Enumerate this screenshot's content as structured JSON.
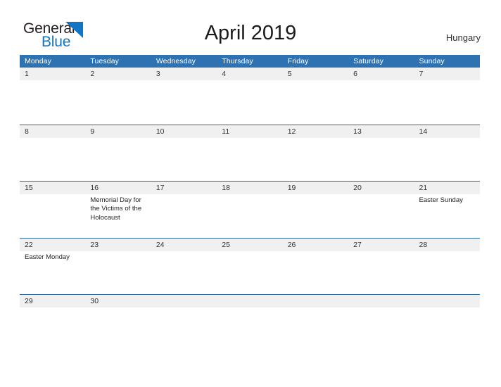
{
  "brand": {
    "name_part1": "General",
    "name_part2": "Blue",
    "mark_icon": "triangle-flag-icon",
    "color_primary": "#1274c4",
    "color_text": "#231f20"
  },
  "header": {
    "title": "April 2019",
    "country": "Hungary"
  },
  "calendar": {
    "header_bg": "#2f72b2",
    "band_bg": "#f0f0f0",
    "rule_color": "#2b669f",
    "weekdays": [
      "Monday",
      "Tuesday",
      "Wednesday",
      "Thursday",
      "Friday",
      "Saturday",
      "Sunday"
    ],
    "weeks": [
      {
        "days": [
          {
            "num": "1",
            "events": []
          },
          {
            "num": "2",
            "events": []
          },
          {
            "num": "3",
            "events": []
          },
          {
            "num": "4",
            "events": []
          },
          {
            "num": "5",
            "events": []
          },
          {
            "num": "6",
            "events": []
          },
          {
            "num": "7",
            "events": []
          }
        ]
      },
      {
        "days": [
          {
            "num": "8",
            "events": []
          },
          {
            "num": "9",
            "events": []
          },
          {
            "num": "10",
            "events": []
          },
          {
            "num": "11",
            "events": []
          },
          {
            "num": "12",
            "events": []
          },
          {
            "num": "13",
            "events": []
          },
          {
            "num": "14",
            "events": []
          }
        ]
      },
      {
        "days": [
          {
            "num": "15",
            "events": []
          },
          {
            "num": "16",
            "events": [
              "Memorial Day for the Victims of the Holocaust"
            ]
          },
          {
            "num": "17",
            "events": []
          },
          {
            "num": "18",
            "events": []
          },
          {
            "num": "19",
            "events": []
          },
          {
            "num": "20",
            "events": []
          },
          {
            "num": "21",
            "events": [
              "Easter Sunday"
            ]
          }
        ]
      },
      {
        "days": [
          {
            "num": "22",
            "events": [
              "Easter Monday"
            ]
          },
          {
            "num": "23",
            "events": []
          },
          {
            "num": "24",
            "events": []
          },
          {
            "num": "25",
            "events": []
          },
          {
            "num": "26",
            "events": []
          },
          {
            "num": "27",
            "events": []
          },
          {
            "num": "28",
            "events": []
          }
        ]
      },
      {
        "days": [
          {
            "num": "29",
            "events": []
          },
          {
            "num": "30",
            "events": []
          },
          {
            "num": "",
            "events": []
          },
          {
            "num": "",
            "events": []
          },
          {
            "num": "",
            "events": []
          },
          {
            "num": "",
            "events": []
          },
          {
            "num": "",
            "events": []
          }
        ]
      }
    ]
  }
}
